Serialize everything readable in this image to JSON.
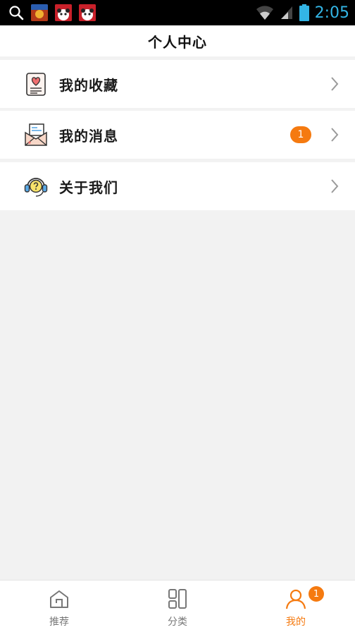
{
  "status_bar": {
    "time": "2:05",
    "notification_icons": [
      "app-notification-icon",
      "panda-notification-icon",
      "panda-notification-icon"
    ]
  },
  "header": {
    "title": "个人中心"
  },
  "menu": {
    "items": [
      {
        "label": "我的收藏",
        "icon": "favorites-icon"
      },
      {
        "label": "我的消息",
        "icon": "message-icon",
        "badge": "1"
      },
      {
        "label": "关于我们",
        "icon": "support-icon"
      }
    ]
  },
  "tabbar": {
    "tabs": [
      {
        "label": "推荐",
        "icon": "home-icon"
      },
      {
        "label": "分类",
        "icon": "category-icon"
      },
      {
        "label": "我的",
        "icon": "user-icon",
        "badge": "1"
      }
    ],
    "active_tab": "我的"
  },
  "colors": {
    "accent": "#f57a10",
    "status_time": "#33b5e5",
    "background": "#f2f2f2"
  }
}
